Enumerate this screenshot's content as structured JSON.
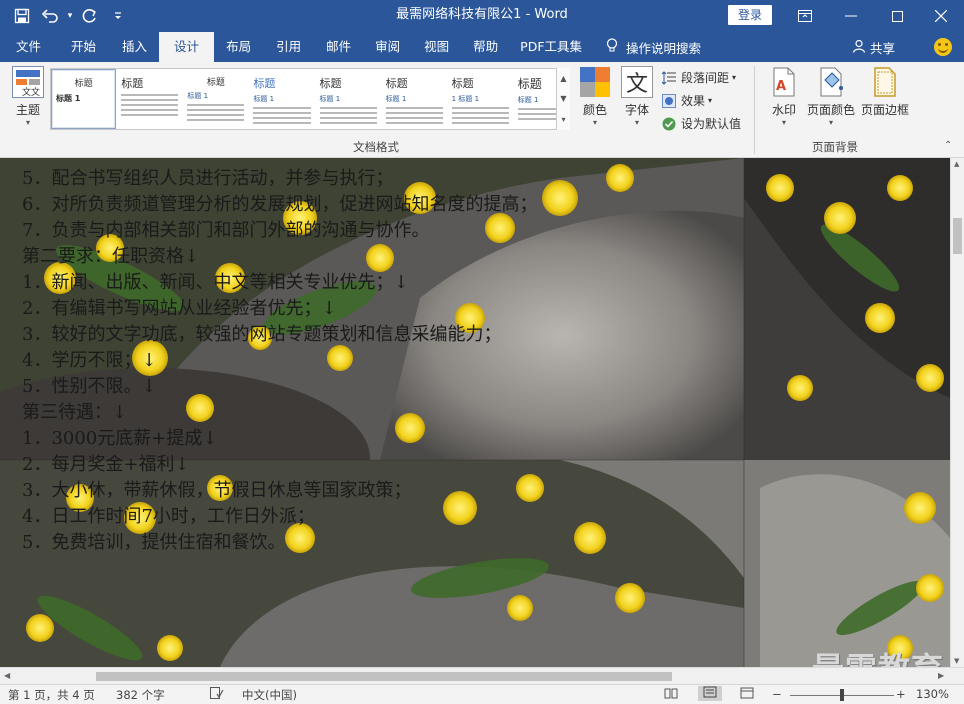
{
  "window": {
    "title": "最需网络科技有限公1 - Word",
    "login_label": "登录",
    "qat": {
      "save": "💾",
      "undo": "↶",
      "redo": "↻",
      "customize": "▾"
    },
    "controls": {
      "ribbon_display": "▭",
      "minimize": "—",
      "maximize": "☐",
      "close": "✕"
    }
  },
  "tabs": [
    {
      "label": "文件"
    },
    {
      "label": "开始"
    },
    {
      "label": "插入"
    },
    {
      "label": "设计",
      "active": true
    },
    {
      "label": "布局"
    },
    {
      "label": "引用"
    },
    {
      "label": "邮件"
    },
    {
      "label": "审阅"
    },
    {
      "label": "视图"
    },
    {
      "label": "帮助"
    },
    {
      "label": "PDF工具集"
    }
  ],
  "tell_me": "操作说明搜索",
  "share_label": "共享",
  "ribbon": {
    "theme_label": "主题",
    "gallery": [
      {
        "title": "标题",
        "sub": "标题 1"
      },
      {
        "title": "标题",
        "sub": ""
      },
      {
        "title": "标题",
        "sub": "标题 1"
      },
      {
        "title": "标题",
        "sub": "标题 1"
      },
      {
        "title": "标题",
        "sub": "标题 1"
      },
      {
        "title": "标题",
        "sub": "标题 1"
      },
      {
        "title": "标题",
        "sub": "1 标题 1"
      },
      {
        "title": "标题",
        "sub": "标题 1"
      }
    ],
    "colors_label": "颜色",
    "fonts_label": "字体",
    "fonts_glyph": "文",
    "paragraph_spacing": "段落间距",
    "effects": "效果",
    "set_default": "设为默认值",
    "doc_format_group": "文档格式",
    "watermark_label": "水印",
    "page_color_label": "页面颜色",
    "page_border_label": "页面边框",
    "page_bg_group": "页面背景"
  },
  "document": {
    "lines": [
      "5．配合书写组织人员进行活动，并参与执行；",
      "6．对所负责频道管理分析的发展规划，促进网站知名度的提高；",
      "7．负责与内部相关部门和部门外部的沟通与协作。",
      "第二要求：任职资格↓",
      "1．新闻、出版、新闻、中文等相关专业优先；↓",
      "2．有编辑书写网站从业经验者优先；↓",
      "3．较好的文字功底，较强的网站专题策划和信息采编能力；",
      "4．学历不限；↓",
      "5．性别不限。↓",
      "第三待遇：↓",
      "1．3000元底薪+提成↓",
      "2．每月奖金+福利↓",
      "3．大小休，带薪休假，节假日休息等国家政策；",
      "4．日工作时间7小时，工作日外派；",
      "5．免费培训，提供住宿和餐饮。"
    ],
    "watermark_text": "最需教育"
  },
  "status": {
    "page": "第 1 页，共 4 页",
    "words": "382 个字",
    "language": "中文(中国)",
    "zoom_minus": "−",
    "zoom_plus": "+",
    "zoom": "130%"
  }
}
